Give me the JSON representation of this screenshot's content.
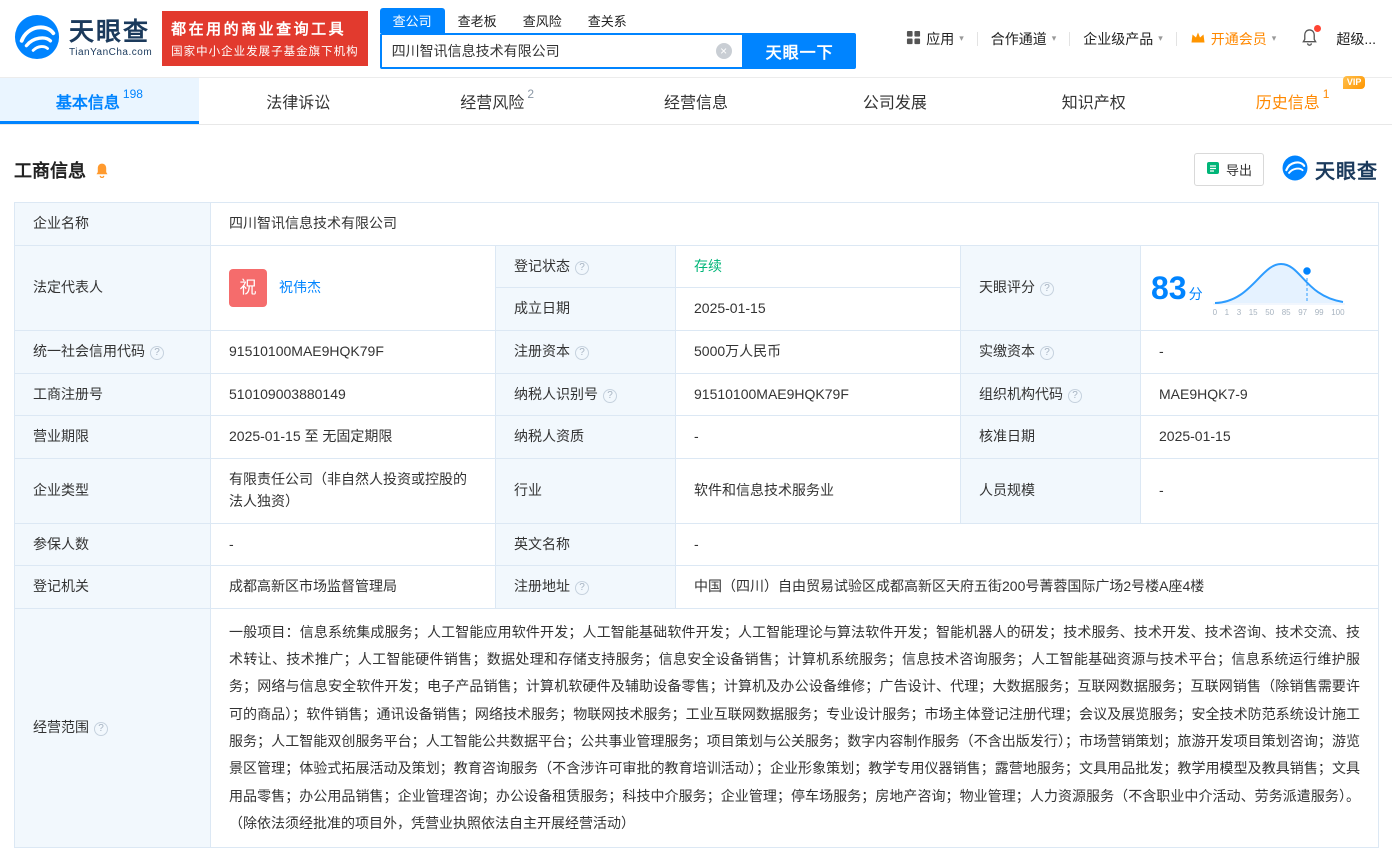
{
  "icons": {
    "help_glyph": "?",
    "caret_glyph": "▾",
    "clear_glyph": "×"
  },
  "colors": {
    "brand_blue": "#0084ff",
    "banner_red": "#e23a2e",
    "vip_orange": "#ff8800",
    "status_green": "#00b578",
    "label_cell_bg": "#f2f8fd"
  },
  "header": {
    "brand": {
      "name": "天眼查",
      "domain": "TianYanCha.com"
    },
    "banner": {
      "line1": "都在用的商业查询工具",
      "line2": "国家中小企业发展子基金旗下机构"
    },
    "search": {
      "tabs": [
        {
          "label": "查公司"
        },
        {
          "label": "查老板"
        },
        {
          "label": "查风险"
        },
        {
          "label": "查关系"
        }
      ],
      "value": "四川智讯信息技术有限公司",
      "button": "天眼一下"
    },
    "nav": {
      "apps": "应用",
      "cooperation": "合作通道",
      "enterprise": "企业级产品",
      "vip": "开通会员",
      "user": "超级..."
    }
  },
  "tabs": [
    {
      "label": "基本信息",
      "badge": "198"
    },
    {
      "label": "法律诉讼",
      "badge": ""
    },
    {
      "label": "经营风险",
      "badge": "2"
    },
    {
      "label": "经营信息",
      "badge": ""
    },
    {
      "label": "公司发展",
      "badge": ""
    },
    {
      "label": "知识产权",
      "badge": ""
    },
    {
      "label": "历史信息",
      "badge": "1",
      "vip_tag": "VIP"
    }
  ],
  "section": {
    "title": "工商信息",
    "export": "导出",
    "brand": "天眼查"
  },
  "info": {
    "company_name": {
      "label": "企业名称",
      "value": "四川智讯信息技术有限公司"
    },
    "legal_rep": {
      "label": "法定代表人",
      "avatar": "祝",
      "name": "祝伟杰"
    },
    "reg_status": {
      "label": "登记状态",
      "value": "存续"
    },
    "est_date": {
      "label": "成立日期",
      "value": "2025-01-15"
    },
    "score": {
      "label": "天眼评分",
      "value": "83",
      "unit": "分",
      "axis": [
        "0",
        "1",
        "3",
        "15",
        "50",
        "85",
        "97",
        "99",
        "100"
      ]
    },
    "credit_code": {
      "label": "统一社会信用代码",
      "value": "91510100MAE9HQK79F"
    },
    "reg_capital": {
      "label": "注册资本",
      "value": "5000万人民币"
    },
    "paid_capital": {
      "label": "实缴资本",
      "value": "-"
    },
    "reg_no": {
      "label": "工商注册号",
      "value": "510109003880149"
    },
    "taxpayer_no": {
      "label": "纳税人识别号",
      "value": "91510100MAE9HQK79F"
    },
    "org_code": {
      "label": "组织机构代码",
      "value": "MAE9HQK7-9"
    },
    "term": {
      "label": "营业期限",
      "value": "2025-01-15 至 无固定期限"
    },
    "taxpayer_quality": {
      "label": "纳税人资质",
      "value": "-"
    },
    "approve_date": {
      "label": "核准日期",
      "value": "2025-01-15"
    },
    "company_type": {
      "label": "企业类型",
      "value": "有限责任公司（非自然人投资或控股的法人独资）"
    },
    "industry": {
      "label": "行业",
      "value": "软件和信息技术服务业"
    },
    "staff": {
      "label": "人员规模",
      "value": "-"
    },
    "insured": {
      "label": "参保人数",
      "value": "-"
    },
    "en_name": {
      "label": "英文名称",
      "value": "-"
    },
    "authority": {
      "label": "登记机关",
      "value": "成都高新区市场监督管理局"
    },
    "address": {
      "label": "注册地址",
      "value": "中国（四川）自由贸易试验区成都高新区天府五街200号菁蓉国际广场2号楼A座4楼"
    },
    "scope": {
      "label": "经营范围",
      "value": "一般项目：信息系统集成服务；人工智能应用软件开发；人工智能基础软件开发；人工智能理论与算法软件开发；智能机器人的研发；技术服务、技术开发、技术咨询、技术交流、技术转让、技术推广；人工智能硬件销售；数据处理和存储支持服务；信息安全设备销售；计算机系统服务；信息技术咨询服务；人工智能基础资源与技术平台；信息系统运行维护服务；网络与信息安全软件开发；电子产品销售；计算机软硬件及辅助设备零售；计算机及办公设备维修；广告设计、代理；大数据服务；互联网数据服务；互联网销售（除销售需要许可的商品）；软件销售；通讯设备销售；网络技术服务；物联网技术服务；工业互联网数据服务；专业设计服务；市场主体登记注册代理；会议及展览服务；安全技术防范系统设计施工服务；人工智能双创服务平台；人工智能公共数据平台；公共事业管理服务；项目策划与公关服务；数字内容制作服务（不含出版发行）；市场营销策划；旅游开发项目策划咨询；游览景区管理；体验式拓展活动及策划；教育咨询服务（不含涉许可审批的教育培训活动）；企业形象策划；教学专用仪器销售；露营地服务；文具用品批发；教学用模型及教具销售；文具用品零售；办公用品销售；企业管理咨询；办公设备租赁服务；科技中介服务；企业管理；停车场服务；房地产咨询；物业管理；人力资源服务（不含职业中介活动、劳务派遣服务）。（除依法须经批准的项目外，凭营业执照依法自主开展经营活动）"
    }
  }
}
